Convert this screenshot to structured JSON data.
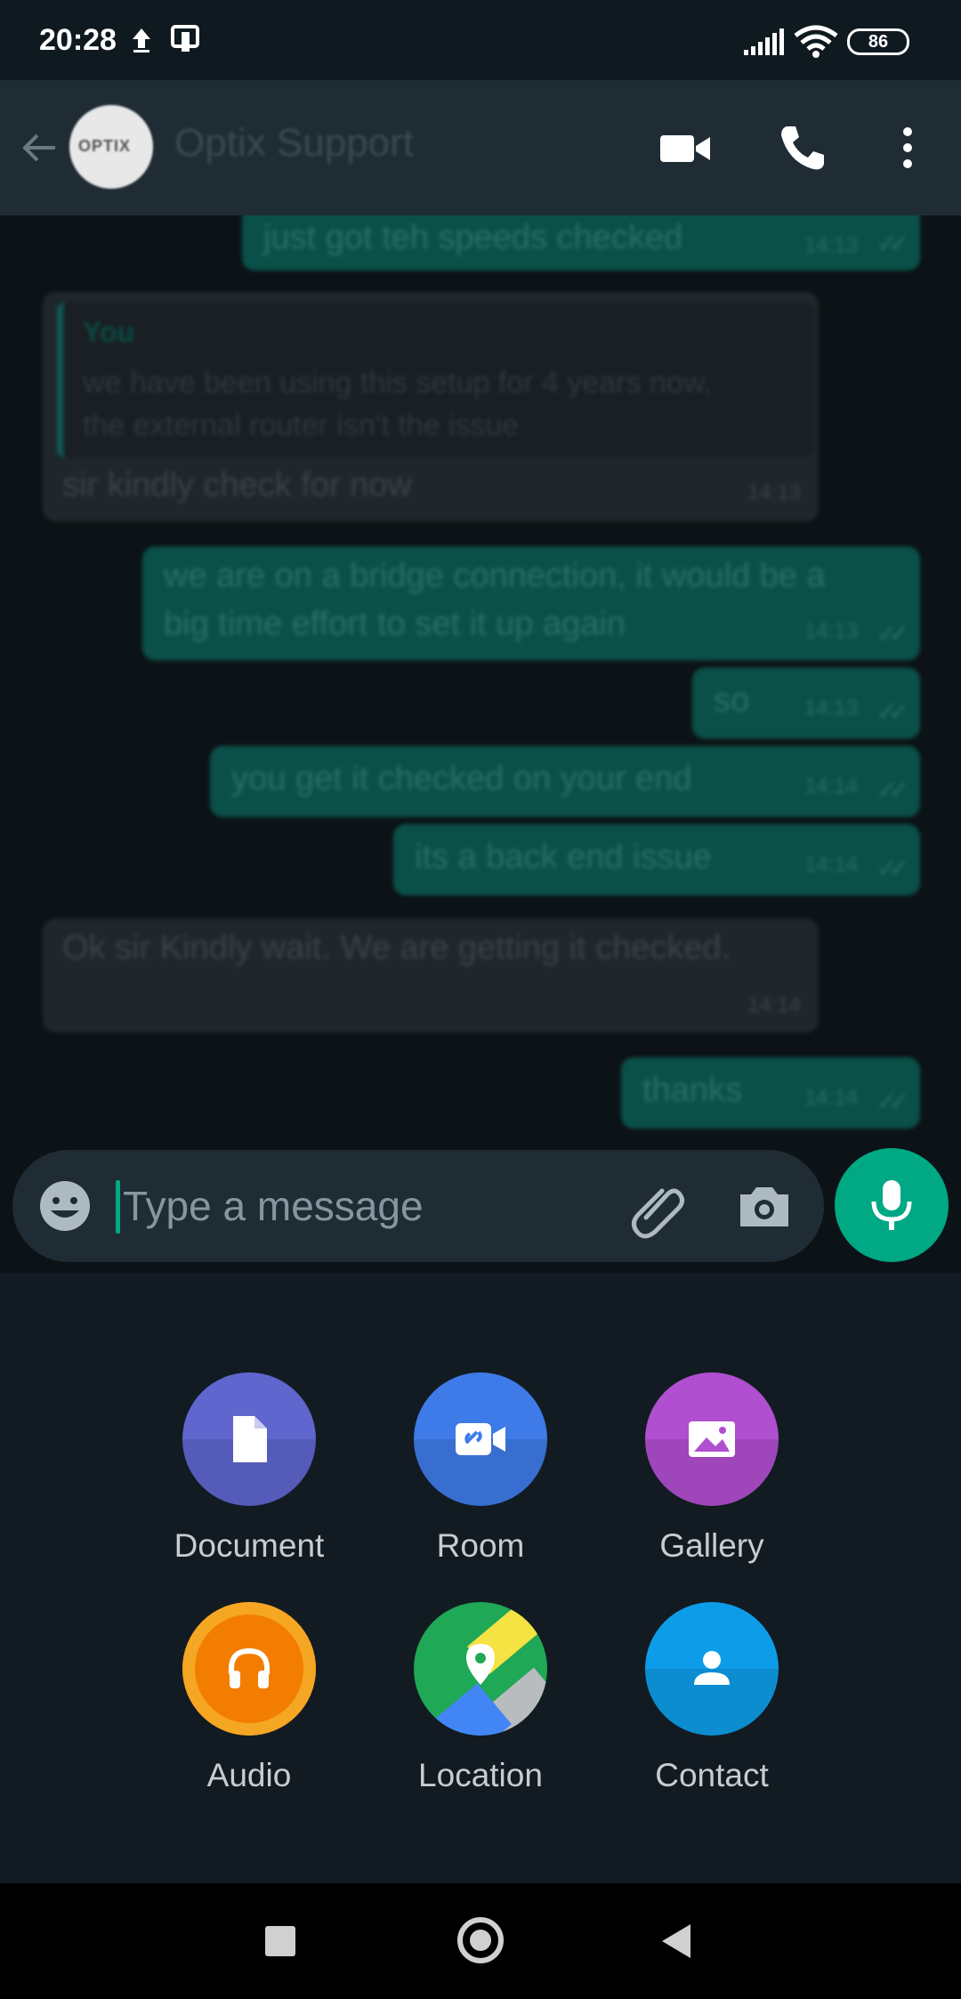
{
  "status_bar": {
    "time": "20:28",
    "battery": "86"
  },
  "header": {
    "title": "Optix Support",
    "avatar_text": "OPTIX"
  },
  "messages": [
    {
      "direction": "out",
      "text": "just got teh speeds checked",
      "time": "14:13"
    },
    {
      "direction": "in",
      "quote_author": "You",
      "quote_text": "we have been using this setup for 4 years now, the external router isn't the issue",
      "text": "sir kindly check for now",
      "time": "14:13"
    },
    {
      "direction": "out",
      "text": "we are on a bridge connection, it would be a big time effort to set it up again",
      "time": "14:13"
    },
    {
      "direction": "out",
      "text": "so",
      "time": "14:13"
    },
    {
      "direction": "out",
      "text": "you get it checked on your end",
      "time": "14:14"
    },
    {
      "direction": "out",
      "text": "its a back end issue",
      "time": "14:14"
    },
    {
      "direction": "in",
      "text": "Ok sir Kindly wait. We are getting it checked.",
      "time": "14:14"
    },
    {
      "direction": "out",
      "text": "thanks",
      "time": "14:14"
    }
  ],
  "input": {
    "placeholder": "Type a message"
  },
  "attachments": [
    {
      "label": "Document",
      "color": "#5f66cd",
      "icon": "document-icon"
    },
    {
      "label": "Room",
      "color": "#3e7be8",
      "icon": "room-icon"
    },
    {
      "label": "Gallery",
      "color": "#b04fd0",
      "icon": "gallery-icon"
    },
    {
      "label": "Audio",
      "color": "#f37d00",
      "icon": "headphones-icon"
    },
    {
      "label": "Location",
      "color": "#1fa855",
      "icon": "location-icon"
    },
    {
      "label": "Contact",
      "color": "#0d9de8",
      "icon": "contact-icon"
    }
  ],
  "colors": {
    "accent": "#00a884",
    "header": "#1f2c34",
    "panel": "#121b22"
  }
}
